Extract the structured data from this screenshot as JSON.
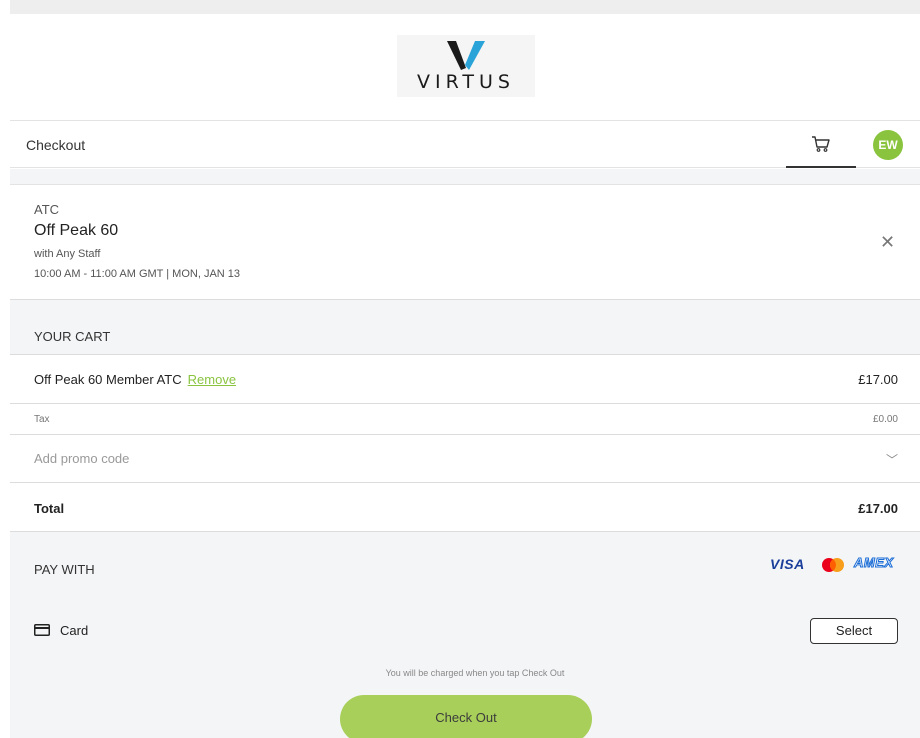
{
  "brand": {
    "logo_text": "VIRTUS"
  },
  "header": {
    "title": "Checkout",
    "avatar_initials": "EW"
  },
  "appointment": {
    "location": "ATC",
    "name": "Off Peak 60",
    "staff": "with Any Staff",
    "time": "10:00 AM - 11:00 AM GMT | MON, JAN 13"
  },
  "cart": {
    "heading": "YOUR CART",
    "item": {
      "name": "Off Peak 60 Member ATC",
      "remove_label": "Remove",
      "price": "£17.00"
    },
    "tax": {
      "label": "Tax",
      "value": "£0.00"
    },
    "promo_label": "Add promo code",
    "total": {
      "label": "Total",
      "value": "£17.00"
    }
  },
  "payment": {
    "heading": "PAY WITH",
    "brands": {
      "visa": "VISA",
      "amex": "AMEX"
    },
    "card_label": "Card",
    "select_label": "Select",
    "charge_note": "You will be charged when you tap Check Out",
    "checkout_label": "Check Out"
  },
  "colors": {
    "accent": "#8ac43f",
    "checkout_button": "#a8cf5a",
    "visa_blue": "#1a3e9a",
    "amex_blue": "#1a6cd6"
  }
}
